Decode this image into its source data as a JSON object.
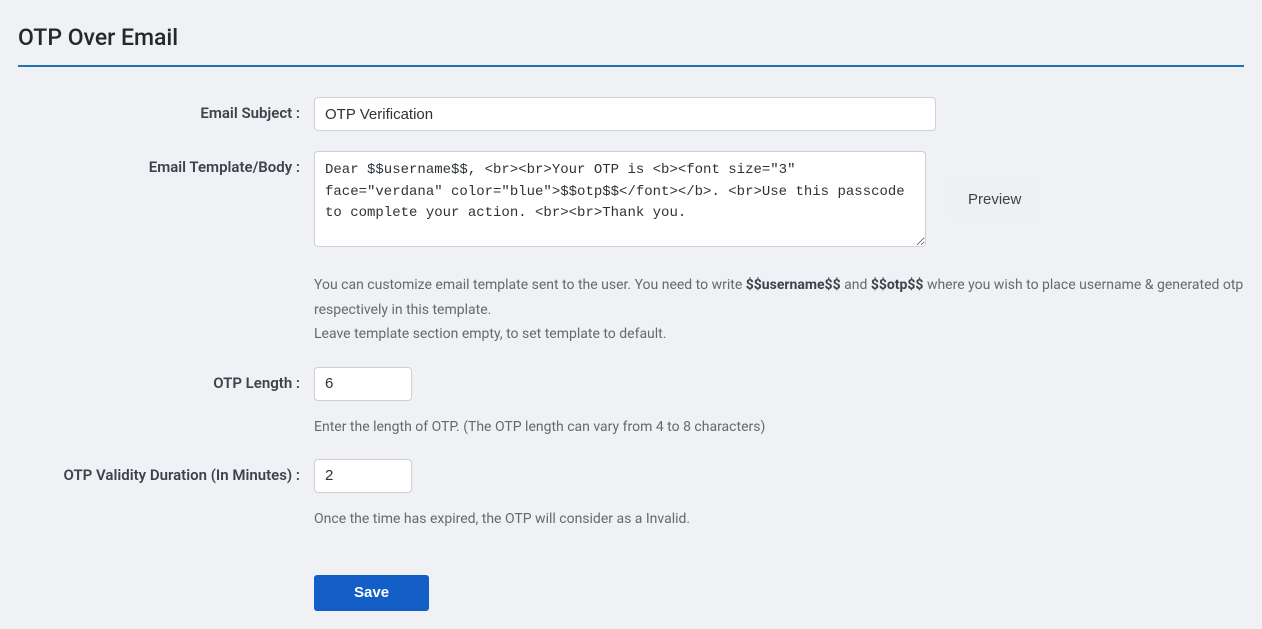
{
  "page": {
    "title": "OTP Over Email"
  },
  "form": {
    "email_subject": {
      "label": "Email Subject :",
      "value": "OTP Verification"
    },
    "email_template": {
      "label": "Email Template/Body :",
      "value": "Dear $$username$$, <br><br>Your OTP is <b><font size=\"3\" face=\"verdana\" color=\"blue\">$$otp$$</font></b>. <br>Use this passcode to complete your action. <br><br>Thank you.",
      "help_prefix": "You can customize email template sent to the user. You need to write ",
      "help_token1": "$$username$$",
      "help_mid": " and ",
      "help_token2": "$$otp$$",
      "help_suffix": " where you wish to place username & generated otp respectively in this template.",
      "help_line2": "Leave template section empty, to set template to default."
    },
    "otp_length": {
      "label": "OTP Length :",
      "value": "6",
      "help": "Enter the length of OTP. (The OTP length can vary from 4 to 8 characters)"
    },
    "otp_validity": {
      "label": "OTP Validity Duration (In Minutes) :",
      "value": "2",
      "help": "Once the time has expired, the OTP will consider as a Invalid."
    }
  },
  "buttons": {
    "preview": "Preview",
    "save": "Save"
  }
}
